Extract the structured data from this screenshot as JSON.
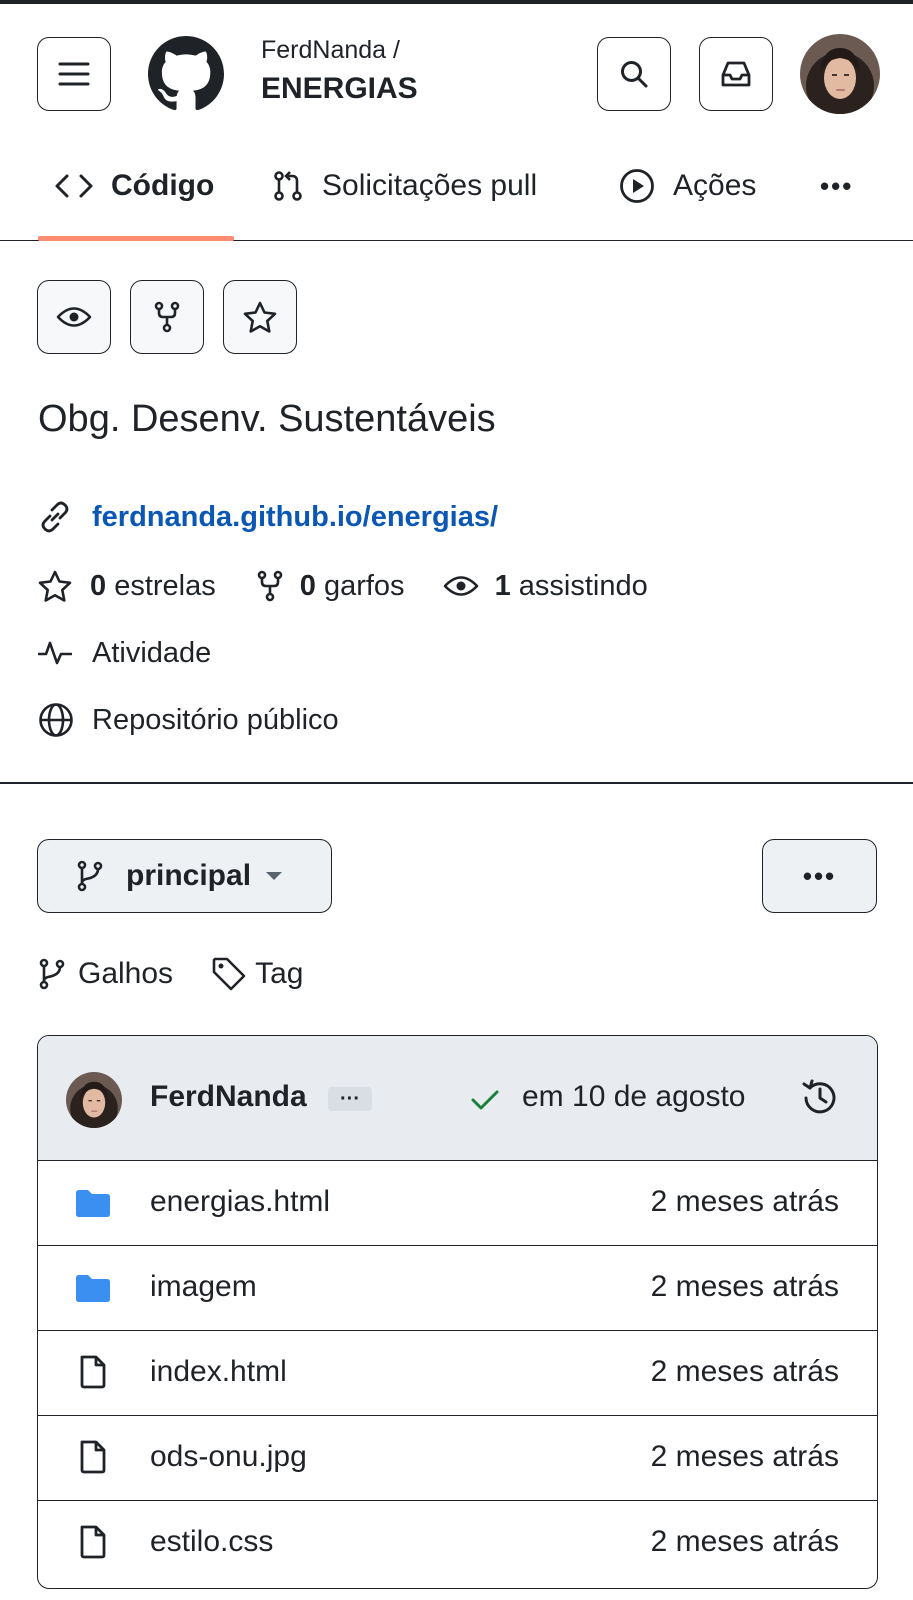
{
  "header": {
    "owner": "FerdNanda /",
    "repo": "ENERGIAS",
    "menu_icon": "hamburger-icon",
    "logo_icon": "github-logo-icon",
    "search_icon": "search-icon",
    "inbox_icon": "inbox-icon"
  },
  "nav": {
    "tabs": [
      {
        "label": "Código",
        "icon": "code-icon",
        "active": true
      },
      {
        "label": "Solicitações pull",
        "icon": "pull-request-icon",
        "active": false
      },
      {
        "label": "Ações",
        "icon": "play-icon",
        "active": false
      }
    ],
    "more_label": "•••"
  },
  "actions": {
    "watch_icon": "eye-icon",
    "fork_icon": "fork-icon",
    "star_icon": "star-icon"
  },
  "repo_info": {
    "description": "Obg. Desenv. Sustentáveis",
    "link": "ferdnanda.github.io/energias/",
    "stars_count": "0",
    "stars_label": "estrelas",
    "forks_count": "0",
    "forks_label": "garfos",
    "watching_count": "1",
    "watching_label": "assistindo",
    "activity_label": "Atividade",
    "visibility_label": "Repositório público"
  },
  "branch": {
    "name": "principal",
    "more_label": "•••",
    "branches_label": "Galhos",
    "tags_label": "Tag"
  },
  "commit": {
    "author": "FerdNanda",
    "dots": "···",
    "date": "em 10 de agosto",
    "status_color": "#1a7f37"
  },
  "files": [
    {
      "name": "energias.html",
      "type": "folder",
      "time": "2 meses atrás"
    },
    {
      "name": "imagem",
      "type": "folder",
      "time": "2 meses atrás"
    },
    {
      "name": "index.html",
      "type": "file",
      "time": "2 meses atrás"
    },
    {
      "name": "ods-onu.jpg",
      "type": "file",
      "time": "2 meses atrás"
    },
    {
      "name": "estilo.css",
      "type": "file",
      "time": "2 meses atrás"
    }
  ],
  "colors": {
    "folder": "#3b8ff0",
    "link": "#0b57b6",
    "tab_underline": "#fd8c73"
  }
}
